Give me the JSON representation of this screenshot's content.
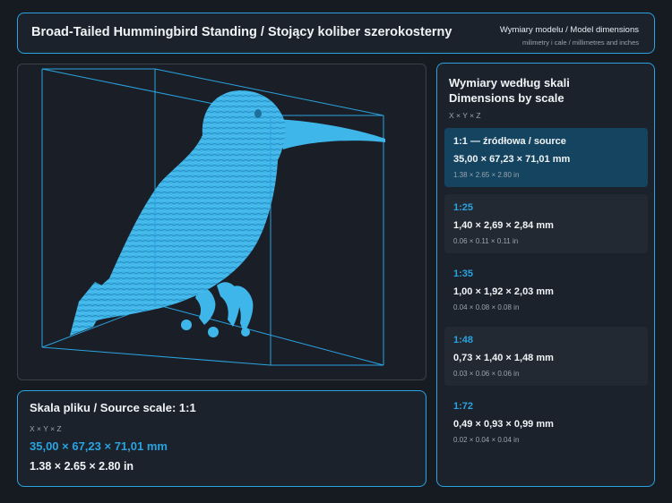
{
  "header": {
    "title": "Broad-Tailed Hummingbird Standing / Stojący koliber szerokosterny",
    "dims_label": "Wymiary modelu / Model dimensions",
    "units_label": "milimetry i cale / millimetres and inches"
  },
  "viewer": {
    "model_color": "#3fb6ea",
    "box_color": "#2aa3e0"
  },
  "source": {
    "title": "Skala pliku / Source scale: 1:1",
    "axes": "X × Y × Z",
    "mm": "35,00 × 67,23 × 71,01 mm",
    "inches": "1.38 × 2.65 × 2.80 in"
  },
  "scales": {
    "title_pl": "Wymiary według skali",
    "title_en": "Dimensions by scale",
    "axes": "X × Y × Z",
    "items": [
      {
        "scale": "1:1  —  źródłowa / source",
        "mm": "35,00 × 67,23 × 71,01 mm",
        "inches": "1.38 × 2.65 × 2.80 in"
      },
      {
        "scale": "1:25",
        "mm": "1,40 × 2,69 × 2,84 mm",
        "inches": "0.06 × 0.11 × 0.11 in"
      },
      {
        "scale": "1:35",
        "mm": "1,00 × 1,92 × 2,03 mm",
        "inches": "0.04 × 0.08 × 0.08 in"
      },
      {
        "scale": "1:48",
        "mm": "0,73 × 1,40 × 1,48 mm",
        "inches": "0.03 × 0.06 × 0.06 in"
      },
      {
        "scale": "1:72",
        "mm": "0,49 × 0,93 × 0,99 mm",
        "inches": "0.02 × 0.04 × 0.04 in"
      }
    ]
  },
  "colors": {
    "accent": "#2aa3e0",
    "background": "#161b22",
    "active_card": "#14445f"
  }
}
